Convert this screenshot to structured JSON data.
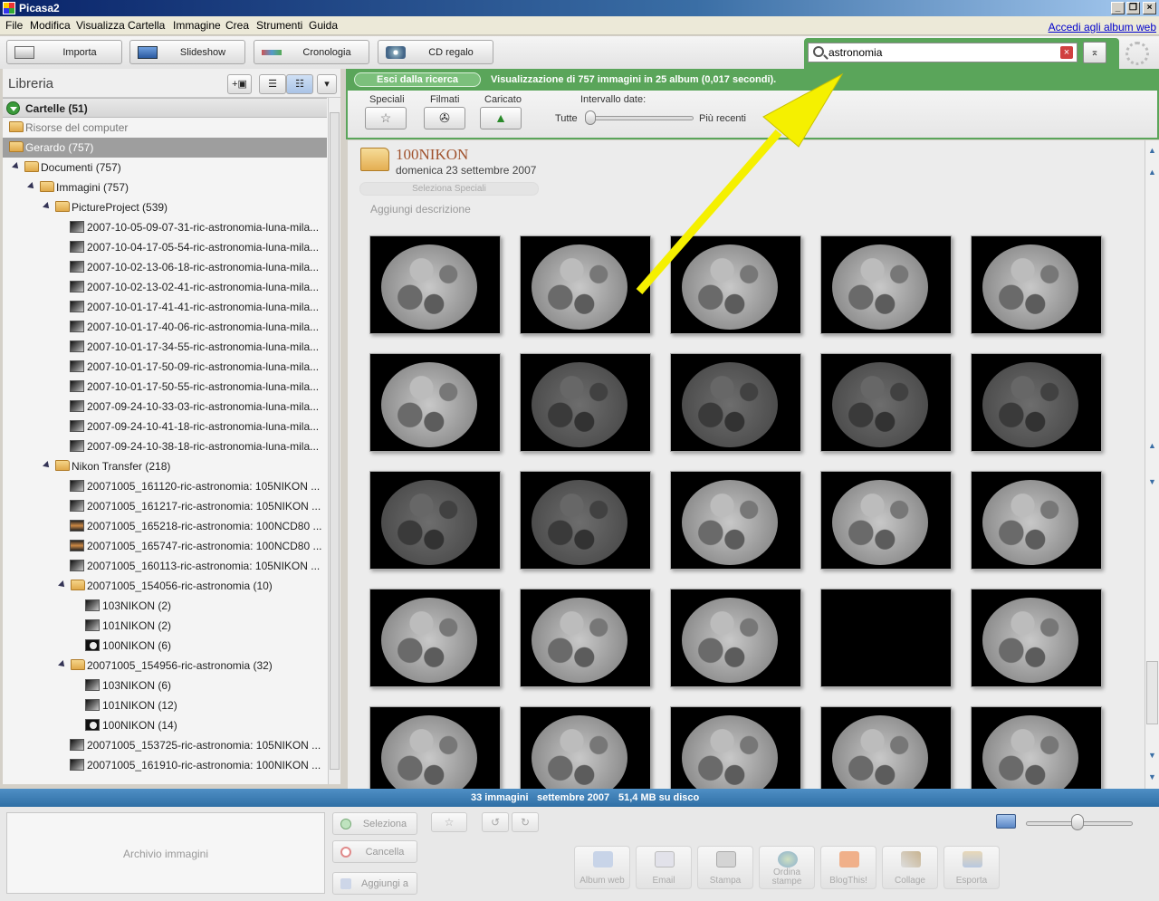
{
  "window": {
    "title": "Picasa2"
  },
  "menu": {
    "items": [
      "File",
      "Modifica",
      "Visualizza",
      "Cartella",
      "Immagine",
      "Crea",
      "Strumenti",
      "Guida"
    ],
    "web_link": "Accedi agli album web"
  },
  "toolbar": {
    "import_label": "Importa",
    "slideshow_label": "Slideshow",
    "timeline_label": "Cronologia",
    "cd_label": "CD regalo"
  },
  "search": {
    "value": "astronomia"
  },
  "library": {
    "title": "Libreria",
    "tree": [
      {
        "label": "Cartelle (51)"
      },
      {
        "label": "Risorse del computer"
      },
      {
        "label": "Gerardo (757)"
      },
      {
        "label": "Documenti (757)"
      },
      {
        "label": "Immagini (757)"
      },
      {
        "label": "PictureProject (539)"
      },
      {
        "label": "2007-10-05-09-07-31-ric-astronomia-luna-mila..."
      },
      {
        "label": "2007-10-04-17-05-54-ric-astronomia-luna-mila..."
      },
      {
        "label": "2007-10-02-13-06-18-ric-astronomia-luna-mila..."
      },
      {
        "label": "2007-10-02-13-02-41-ric-astronomia-luna-mila..."
      },
      {
        "label": "2007-10-01-17-41-41-ric-astronomia-luna-mila..."
      },
      {
        "label": "2007-10-01-17-40-06-ric-astronomia-luna-mila..."
      },
      {
        "label": "2007-10-01-17-34-55-ric-astronomia-luna-mila..."
      },
      {
        "label": "2007-10-01-17-50-09-ric-astronomia-luna-mila..."
      },
      {
        "label": "2007-10-01-17-50-55-ric-astronomia-luna-mila..."
      },
      {
        "label": "2007-09-24-10-33-03-ric-astronomia-luna-mila..."
      },
      {
        "label": "2007-09-24-10-41-18-ric-astronomia-luna-mila..."
      },
      {
        "label": "2007-09-24-10-38-18-ric-astronomia-luna-mila..."
      },
      {
        "label": "Nikon Transfer (218)"
      },
      {
        "label": "20071005_161120-ric-astronomia: 105NIKON ..."
      },
      {
        "label": "20071005_161217-ric-astronomia: 105NIKON ..."
      },
      {
        "label": "20071005_165218-ric-astronomia: 100NCD80 ..."
      },
      {
        "label": "20071005_165747-ric-astronomia: 100NCD80 ..."
      },
      {
        "label": "20071005_160113-ric-astronomia: 105NIKON ..."
      },
      {
        "label": "20071005_154056-ric-astronomia (10)"
      },
      {
        "label": "103NIKON (2)"
      },
      {
        "label": "101NIKON (2)"
      },
      {
        "label": "100NIKON (6)"
      },
      {
        "label": "20071005_154956-ric-astronomia (32)"
      },
      {
        "label": "103NIKON (6)"
      },
      {
        "label": "101NIKON (12)"
      },
      {
        "label": "100NIKON (14)"
      },
      {
        "label": "20071005_153725-ric-astronomia: 105NIKON ..."
      },
      {
        "label": "20071005_161910-ric-astronomia: 100NIKON ..."
      }
    ]
  },
  "search_bar": {
    "exit_label": "Esci dalla ricerca",
    "info": "Visualizzazione di 757 immagini in 25 album (0,017 secondi)."
  },
  "filters": {
    "starred_label": "Speciali",
    "movies_label": "Filmati",
    "uploaded_label": "Caricato",
    "date_range_label": "Intervallo date:",
    "all_label": "Tutte",
    "recent_label": "Più recenti"
  },
  "album": {
    "name": "100NIKON",
    "date": "domenica 23 settembre 2007",
    "select_starred": "Seleziona Speciali",
    "add_description": "Aggiungi descrizione",
    "photos": [
      "bright",
      "bright",
      "bright",
      "bright",
      "bright",
      "bright",
      "dim",
      "dim",
      "dim",
      "dim",
      "dim",
      "dim",
      "bright",
      "bright",
      "bright",
      "bright",
      "bright",
      "bright",
      "blank",
      "bright",
      "bright",
      "bright",
      "bright",
      "bright",
      "bright"
    ]
  },
  "status": {
    "count": "33 immagini",
    "date": "settembre 2007",
    "size": "51,4 MB su disco"
  },
  "tray": {
    "title": "Archivio immagini",
    "select_label": "Seleziona",
    "clear_label": "Cancella",
    "add_to_label": "Aggiungi a",
    "actions": [
      {
        "label": "Album web"
      },
      {
        "label": "Email"
      },
      {
        "label": "Stampa"
      },
      {
        "label": "Ordina stampe"
      },
      {
        "label": "BlogThis!"
      },
      {
        "label": "Collage"
      },
      {
        "label": "Esporta"
      }
    ]
  },
  "colors": {
    "accent_green": "#5aa55a",
    "status_blue": "#2f6fa5",
    "arrow_yellow": "#f5f000"
  }
}
